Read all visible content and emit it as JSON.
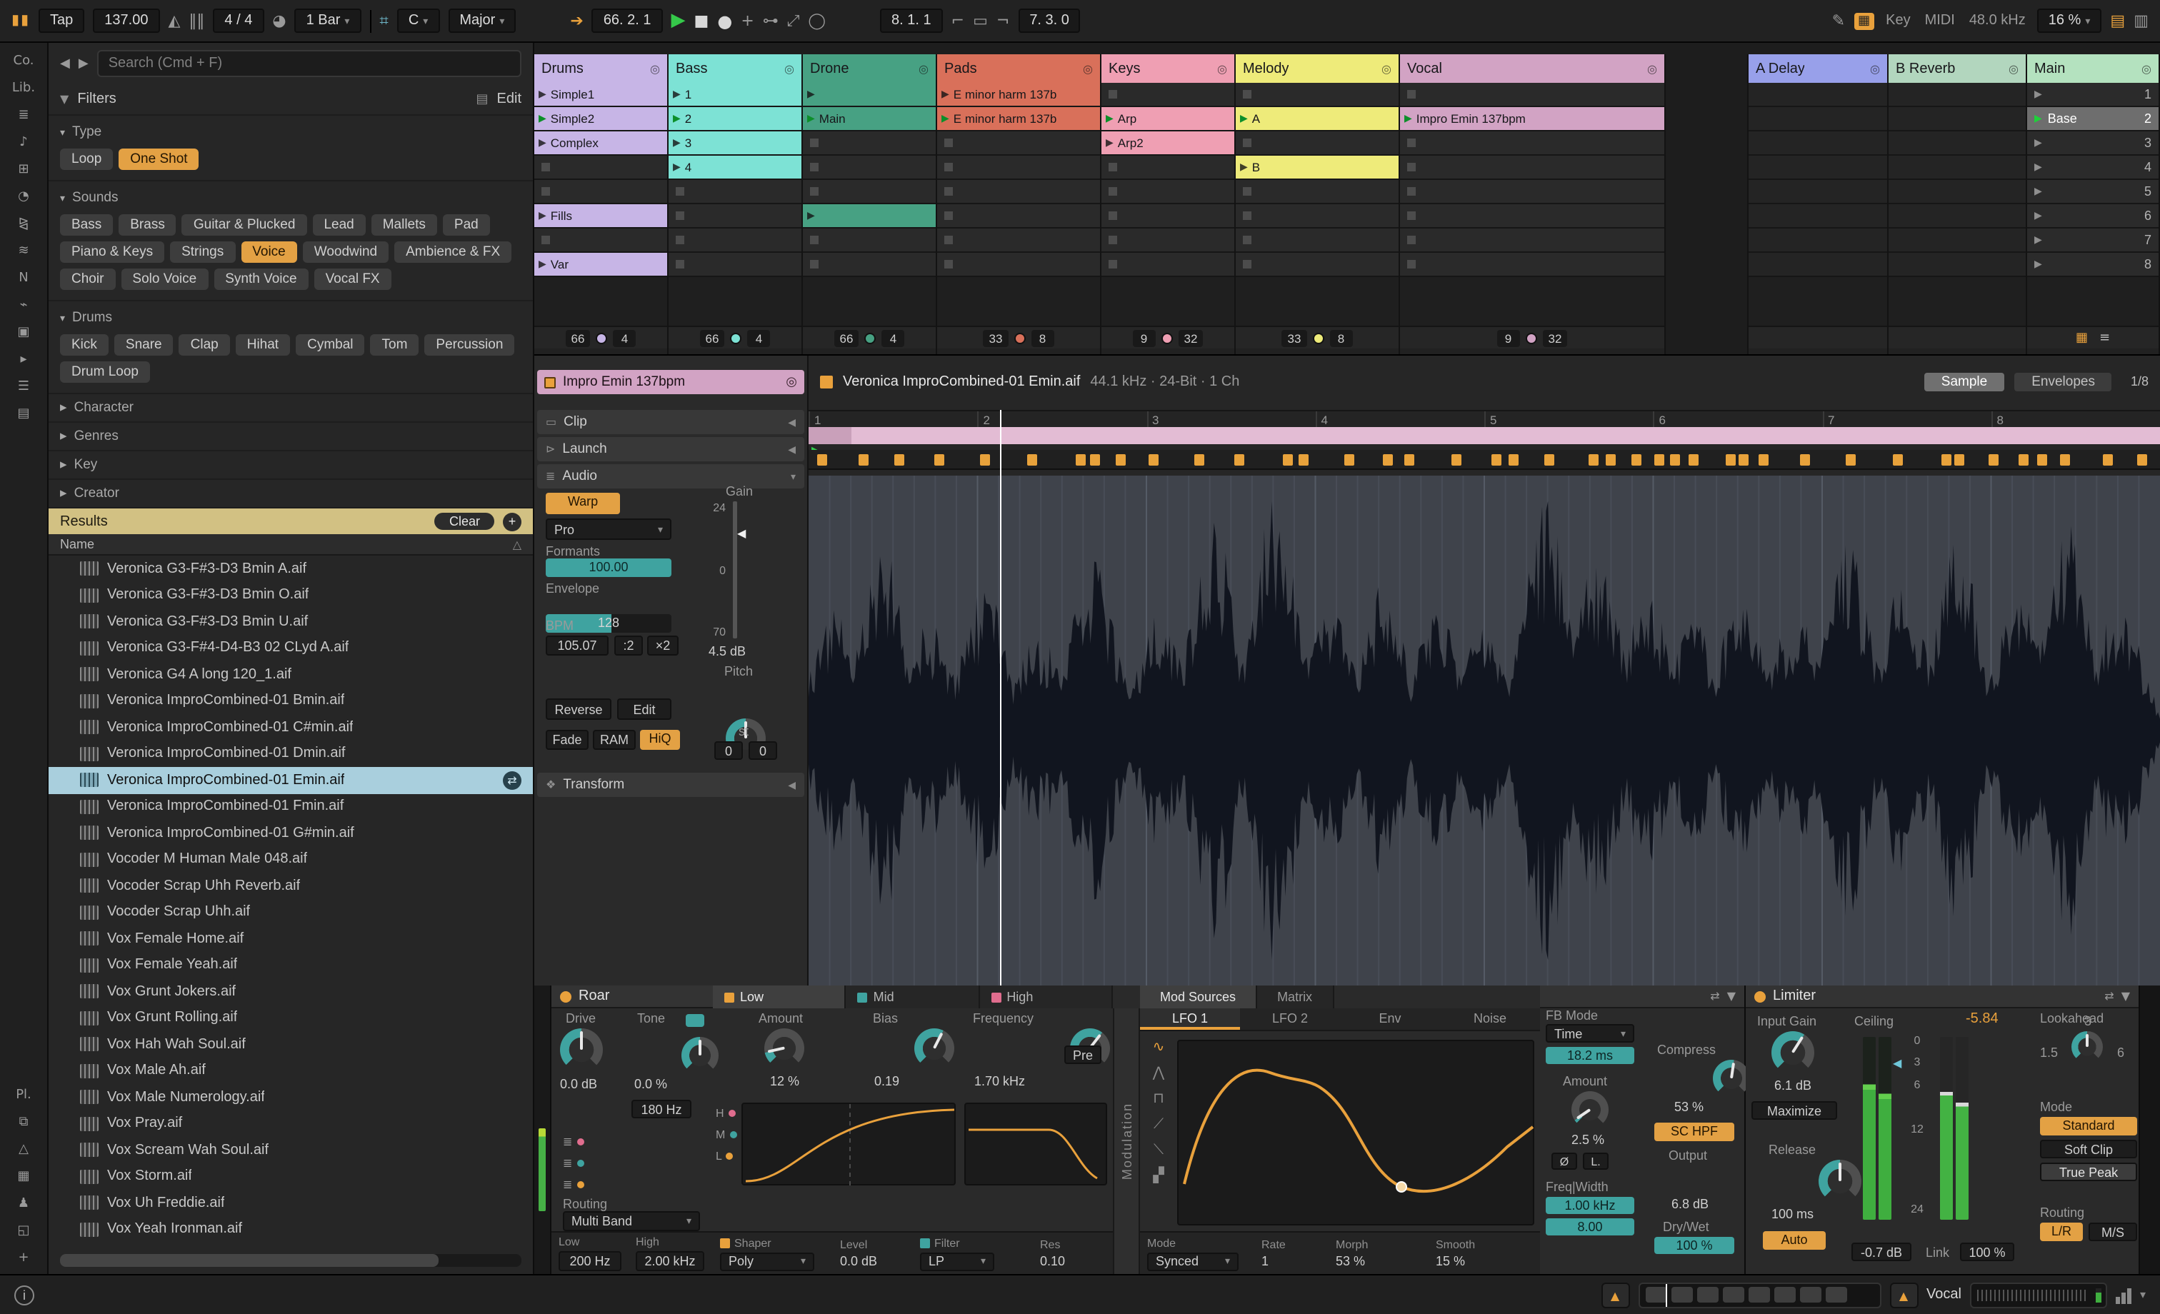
{
  "transport": {
    "tap": "Tap",
    "tempo": "137.00",
    "time_sig": "4 / 4",
    "quantize": "1 Bar",
    "key_root": "C",
    "key_scale": "Major",
    "position": "66. 2. 1",
    "loop_start": "8. 1. 1",
    "loop_length": "7. 3. 0",
    "key_label": "Key",
    "midi_label": "MIDI",
    "sample_rate": "48.0 kHz",
    "cpu": "16 %"
  },
  "left_rail": {
    "items": [
      {
        "name": "collections-label",
        "glyph": "Co."
      },
      {
        "name": "library-label",
        "glyph": "Lib."
      },
      {
        "name": "sounds-icon",
        "glyph": "≣"
      },
      {
        "name": "instruments-icon",
        "glyph": "♪"
      },
      {
        "name": "drums-icon",
        "glyph": "⊞"
      },
      {
        "name": "audio-effects-icon",
        "glyph": "◔"
      },
      {
        "name": "midi-effects-icon",
        "glyph": "⧎"
      },
      {
        "name": "wavetable-icon",
        "glyph": "≋"
      },
      {
        "name": "max-for-live-icon",
        "glyph": "N"
      },
      {
        "name": "plugins-icon",
        "glyph": "⌁"
      },
      {
        "name": "clips-icon",
        "glyph": "▣"
      },
      {
        "name": "samples-icon",
        "glyph": "▸"
      },
      {
        "name": "grooves-icon",
        "glyph": "☰"
      },
      {
        "name": "templates-icon",
        "glyph": "▤"
      },
      {
        "spacer": true
      },
      {
        "name": "places-label",
        "glyph": "Pl."
      },
      {
        "name": "packs-icon",
        "glyph": "⧉"
      },
      {
        "name": "cloud-icon",
        "glyph": "△"
      },
      {
        "name": "drives-icon",
        "glyph": "▦"
      },
      {
        "name": "user-library-icon",
        "glyph": "♟"
      },
      {
        "name": "current-project-icon",
        "glyph": "◱"
      },
      {
        "name": "add-folder-icon",
        "glyph": "+"
      }
    ]
  },
  "browser": {
    "search_placeholder": "Search (Cmd + F)",
    "filters_label": "Filters",
    "edit_label": "Edit",
    "type_label": "Type",
    "type_tags": [
      "Loop",
      "One Shot"
    ],
    "type_selected": "One Shot",
    "sounds_label": "Sounds",
    "sounds_tags": [
      "Bass",
      "Brass",
      "Guitar & Plucked",
      "Lead",
      "Mallets",
      "Pad",
      "Piano & Keys",
      "Strings",
      "Voice",
      "Woodwind",
      "Ambience & FX",
      "Choir",
      "Solo Voice",
      "Synth Voice",
      "Vocal FX"
    ],
    "sounds_selected": "Voice",
    "drums_label": "Drums",
    "drums_tags": [
      "Kick",
      "Snare",
      "Clap",
      "Hihat",
      "Cymbal",
      "Tom",
      "Percussion",
      "Drum Loop"
    ],
    "collapsed_sections": [
      "Character",
      "Genres",
      "Key",
      "Creator"
    ],
    "results_label": "Results",
    "clear_label": "Clear",
    "add_label": "+",
    "name_header": "Name",
    "selected_index": 8,
    "files": [
      "Veronica G3-F#3-D3 Bmin A.aif",
      "Veronica G3-F#3-D3 Bmin O.aif",
      "Veronica G3-F#3-D3 Bmin U.aif",
      "Veronica G3-F#4-D4-B3 02 CLyd A.aif",
      "Veronica G4 A long 120_1.aif",
      "Veronica ImproCombined-01 Bmin.aif",
      "Veronica ImproCombined-01 C#min.aif",
      "Veronica ImproCombined-01 Dmin.aif",
      "Veronica ImproCombined-01 Emin.aif",
      "Veronica ImproCombined-01 Fmin.aif",
      "Veronica ImproCombined-01 G#min.aif",
      "Vocoder M Human Male 048.aif",
      "Vocoder Scrap Uhh Reverb.aif",
      "Vocoder Scrap Uhh.aif",
      "Vox Female Home.aif",
      "Vox Female Yeah.aif",
      "Vox Grunt Jokers.aif",
      "Vox Grunt Rolling.aif",
      "Vox Hah Wah Soul.aif",
      "Vox Male Ah.aif",
      "Vox Male Numerology.aif",
      "Vox Pray.aif",
      "Vox Scream Wah Soul.aif",
      "Vox Storm.aif",
      "Vox Uh Freddie.aif",
      "Vox Yeah Ironman.aif"
    ]
  },
  "session": {
    "tracks": [
      {
        "name": "Drums",
        "color": "#c7b5e6",
        "counters": [
          "66",
          "4"
        ],
        "slots": [
          {
            "c": "Simple1"
          },
          {
            "c": "Simple2",
            "p": true
          },
          {
            "c": "Complex"
          },
          {},
          {},
          {
            "c": "Fills"
          },
          {},
          {
            "c": "Var"
          }
        ]
      },
      {
        "name": "Bass",
        "color": "#7de2d5",
        "counters": [
          "66",
          "4"
        ],
        "slots": [
          {
            "c": "1"
          },
          {
            "c": "2",
            "p": true
          },
          {
            "c": "3"
          },
          {
            "c": "4"
          },
          {},
          {},
          {},
          {}
        ]
      },
      {
        "name": "Drone",
        "color": "#47a183",
        "counters": [
          "66",
          "4"
        ],
        "slots": [
          {
            "c": ""
          },
          {
            "c": "Main",
            "p": true
          },
          {},
          {},
          {},
          {
            "c": ""
          },
          {},
          {}
        ]
      },
      {
        "name": "Pads",
        "color": "#d9705a",
        "counters": [
          "33",
          "8"
        ],
        "slots": [
          {
            "c": "E minor harm 137b"
          },
          {
            "c": "E minor harm 137b",
            "p": true
          },
          {},
          {},
          {},
          {},
          {},
          {}
        ]
      },
      {
        "name": "Keys",
        "color": "#ef9fb3",
        "counters": [
          "9",
          "32"
        ],
        "slots": [
          {},
          {
            "c": "Arp",
            "p": true
          },
          {
            "c": "Arp2"
          },
          {},
          {},
          {},
          {},
          {}
        ]
      },
      {
        "name": "Melody",
        "color": "#eeeb7a",
        "counters": [
          "33",
          "8"
        ],
        "slots": [
          {},
          {
            "c": "A",
            "p": true
          },
          {},
          {
            "c": "B"
          },
          {},
          {},
          {},
          {}
        ]
      },
      {
        "name": "Vocal",
        "color": "#d2a3c4",
        "counters": [
          "9",
          "32"
        ],
        "slots": [
          {},
          {
            "c": "Impro Emin 137bpm",
            "p": true
          },
          {},
          {},
          {},
          {},
          {},
          {}
        ]
      }
    ],
    "returns": [
      {
        "name": "A Delay",
        "color": "#98a0ea"
      },
      {
        "name": "B Reverb",
        "color": "#b2d6be"
      }
    ],
    "main": {
      "name": "Main",
      "color": "#b4e2bf",
      "scenes": [
        "1",
        "2",
        "3",
        "4",
        "5",
        "6",
        "7",
        "8"
      ],
      "selected_scene_index": 1,
      "selected_scene_label": "Base"
    }
  },
  "clip": {
    "title": "Impro Emin 137bpm",
    "section_clip": "Clip",
    "section_launch": "Launch",
    "section_audio": "Audio",
    "warp_label": "Warp",
    "warp_mode": "Pro",
    "formants_label": "Formants",
    "formants_value": "100.00",
    "envelope_label": "Envelope",
    "envelope_value": "128",
    "bpm_label": "BPM",
    "bpm_value": "105.07",
    "half_label": ":2",
    "double_label": "×2",
    "reverse_label": "Reverse",
    "edit_label": "Edit",
    "fade_label": "Fade",
    "ram_label": "RAM",
    "hiq_label": "HiQ",
    "gain_label": "Gain",
    "gain_scale": [
      "24",
      "0",
      "70"
    ],
    "gain_value": "4.5 dB",
    "pitch_label": "Pitch",
    "pitch_unit": "st",
    "pitch_semi": "0",
    "pitch_cents": "0",
    "transform_label": "Transform"
  },
  "sample": {
    "file_info": "Veronica ImproCombined-01 Emin.aif",
    "format_info": "44.1 kHz · 24-Bit · 1 Ch",
    "tab_sample": "Sample",
    "tab_envelopes": "Envelopes",
    "page_indicator": "1/8",
    "ruler": [
      "1",
      "2",
      "3",
      "4",
      "5",
      "6",
      "7",
      "8"
    ]
  },
  "roar": {
    "title": "Roar",
    "drive_label": "Drive",
    "drive_value": "0.0 dB",
    "tone_label": "Tone",
    "tone_value": "0.0 %",
    "tone_freq": "180 Hz",
    "routing_label": "Routing",
    "routing_mode": "Multi Band",
    "low_label": "Low",
    "low_freq": "200 Hz",
    "high_label": "High",
    "high_freq": "2.00 kHz",
    "band_tabs": [
      "Low",
      "Mid",
      "High"
    ],
    "amount_label": "Amount",
    "amount_value": "12 %",
    "bias_label": "Bias",
    "bias_value": "0.19",
    "frequency_label": "Frequency",
    "frequency_value": "1.70 kHz",
    "pre_label": "Pre",
    "shaper_label": "Shaper",
    "shaper_type": "Poly",
    "level_label": "Level",
    "level_value": "0.0 dB",
    "filter_label": "Filter",
    "filter_type": "LP",
    "res_label": "Res",
    "res_value": "0.10",
    "mod_tabs": [
      "Mod Sources",
      "Matrix"
    ],
    "lfo_tabs": [
      "LFO 1",
      "LFO 2",
      "Env",
      "Noise"
    ],
    "mode_label": "Mode",
    "mode_value": "Synced",
    "rate_label": "Rate",
    "rate_value": "1",
    "morph_label": "Morph",
    "morph_value": "53 %",
    "smooth_label": "Smooth",
    "smooth_value": "15 %",
    "fb_mode_label": "FB Mode",
    "fb_mode_value": "Time",
    "fb_time": "18.2 ms",
    "fb_amount_label": "Amount",
    "fb_amount_value": "2.5 %",
    "phase_label": "Ø",
    "limit_label": "L.",
    "sc_hpf_label": "SC HPF",
    "compress_label": "Compress",
    "compress_value": "53 %",
    "output_label": "Output",
    "output_value": "6.8 dB",
    "freq_width_label": "Freq|Width",
    "freq_value": "1.00 kHz",
    "width_value": "8.00",
    "dry_wet_label": "Dry/Wet",
    "dry_wet_value": "100 %",
    "modulation_label": "Modulation"
  },
  "limiter": {
    "title": "Limiter",
    "input_gain_label": "Input Gain",
    "input_gain_value": "6.1 dB",
    "maximize_label": "Maximize",
    "ceiling_label": "Ceiling",
    "ceiling_value": "-5.84",
    "meter_scale": [
      "0",
      "3",
      "6",
      "12",
      "24"
    ],
    "release_label": "Release",
    "release_value": "100 ms",
    "auto_label": "Auto",
    "gain_reduction": "-0.7 dB",
    "link_label": "Link",
    "link_value": "100 %",
    "lookahead_label": "Lookahead",
    "tick_a": "1.5",
    "tick_b": "3",
    "tick_c": "6",
    "mode_label": "Mode",
    "mode_value": "Standard",
    "soft_clip_label": "Soft Clip",
    "true_peak_label": "True Peak",
    "routing_label": "Routing",
    "routing_lr": "L/R",
    "routing_ms": "M/S"
  },
  "statusbar": {
    "info_label": "i",
    "track_name": "Vocal"
  }
}
